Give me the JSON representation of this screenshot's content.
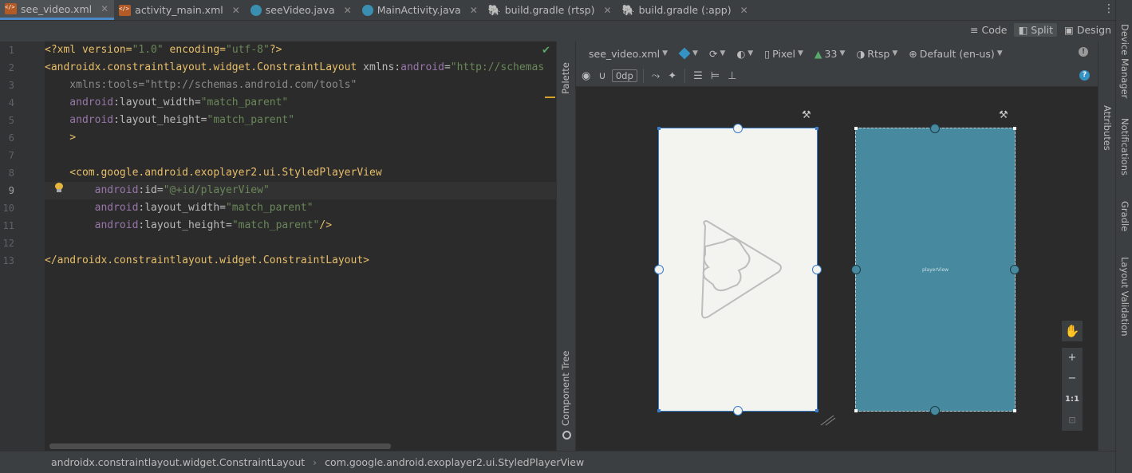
{
  "tabs": [
    {
      "label": "see_video.xml",
      "icon": "xml-file-icon",
      "active": true
    },
    {
      "label": "activity_main.xml",
      "icon": "xml-file-icon",
      "active": false
    },
    {
      "label": "seeVideo.java",
      "icon": "java-class-icon",
      "active": false
    },
    {
      "label": "MainActivity.java",
      "icon": "java-class-icon",
      "active": false
    },
    {
      "label": "build.gradle (rtsp)",
      "icon": "gradle-icon",
      "active": false
    },
    {
      "label": "build.gradle (:app)",
      "icon": "gradle-icon",
      "active": false
    }
  ],
  "view_modes": {
    "code": "Code",
    "split": "Split",
    "design": "Design",
    "selected": "Split"
  },
  "editor": {
    "line_numbers": [
      "1",
      "2",
      "3",
      "4",
      "5",
      "6",
      "7",
      "8",
      "9",
      "10",
      "11",
      "12",
      "13"
    ],
    "current_line": "9",
    "lines": {
      "l1": {
        "a": "<?xml version=",
        "b": "\"1.0\"",
        "c": " encoding=",
        "d": "\"utf-8\"",
        "e": "?>"
      },
      "l2": {
        "a": "<androidx.constraintlayout.widget.ConstraintLayout",
        "b": " xmlns:",
        "c": "android",
        "d": "=",
        "e": "\"http://schemas"
      },
      "l3": {
        "a": "    xmlns:tools=\"http://schemas.android.com/tools\""
      },
      "l4": {
        "a": "    android",
        "b": ":layout_width=",
        "c": "\"match_parent\""
      },
      "l5": {
        "a": "    android",
        "b": ":layout_height=",
        "c": "\"match_parent\""
      },
      "l6": {
        "a": "    >"
      },
      "l8": {
        "a": "    <com.google.android.exoplayer2.ui.StyledPlayerView"
      },
      "l9": {
        "a": "        android",
        "b": ":id=",
        "c": "\"@+id/playerView\""
      },
      "l10": {
        "a": "        android",
        "b": ":layout_width=",
        "c": "\"match_parent\""
      },
      "l11": {
        "a": "        android",
        "b": ":layout_height=",
        "c": "\"match_parent\"",
        "d": "/>"
      },
      "l13": {
        "a": "</androidx.constraintlayout.widget.ConstraintLayout>"
      }
    }
  },
  "side_panels": {
    "palette": "Palette",
    "component_tree": "Component Tree",
    "attributes": "Attributes"
  },
  "design_toolbar": {
    "file": "see_video.xml",
    "device": "Pixel",
    "api": "33",
    "theme": "Rtsp",
    "locale": "Default (en-us)",
    "margin": "0dp"
  },
  "blueprint_label": "playerView",
  "zoom": {
    "plus": "+",
    "minus": "−",
    "fit": "1:1"
  },
  "right_tools": {
    "device_manager": "Device Manager",
    "notifications": "Notifications",
    "gradle": "Gradle",
    "layout_validation": "Layout Validation"
  },
  "breadcrumb": {
    "parent": "androidx.constraintlayout.widget.ConstraintLayout",
    "child": "com.google.android.exoplayer2.ui.StyledPlayerView"
  },
  "colors": {
    "accent": "#4a88c7",
    "blueprint": "#478aa0",
    "design_bg": "#f3f3f0"
  }
}
